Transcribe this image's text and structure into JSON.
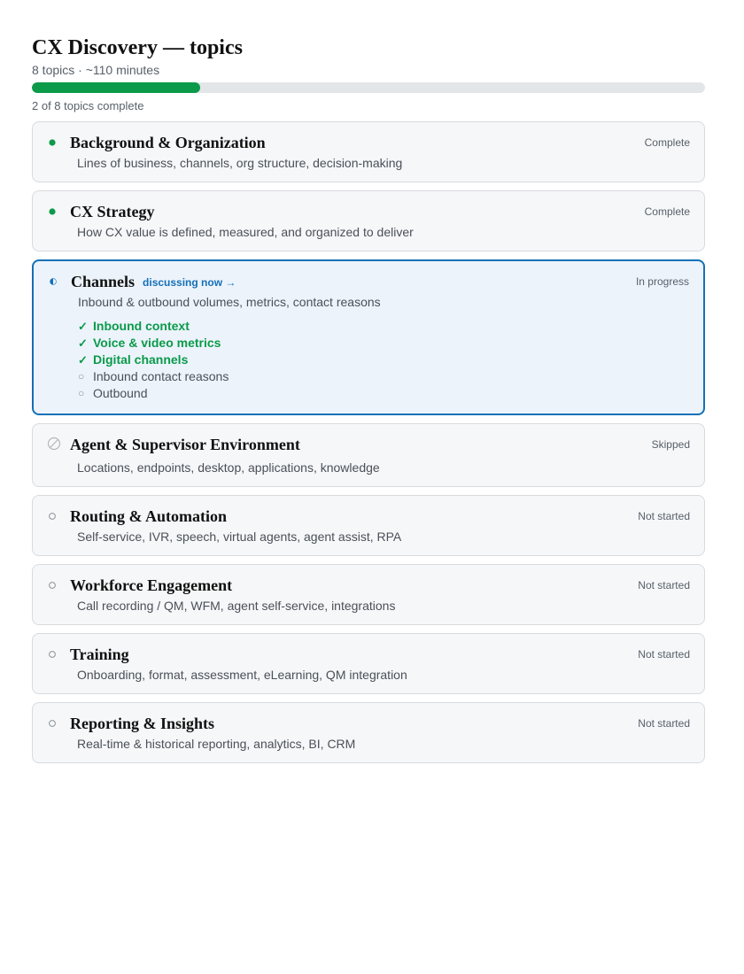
{
  "header": {
    "title": "CX Discovery — topics",
    "subtitle": "8 topics · ~110 minutes"
  },
  "progress": {
    "completed": 2,
    "total": 8,
    "fraction": 0.25,
    "caption": "2 of 8 topics complete"
  },
  "colors": {
    "complete": "#0a9a4a",
    "active": "#1470b8",
    "muted": "#8b939c"
  },
  "topics": [
    {
      "title": "Background & Organization",
      "description": "Lines of business, channels, org structure, decision-making",
      "status": "Complete",
      "icon": "filled-dot-icon"
    },
    {
      "title": "CX Strategy",
      "description": "How CX value is defined, measured, and organized to deliver",
      "status": "Complete",
      "icon": "filled-dot-icon"
    },
    {
      "title": "Channels",
      "description": "Inbound & outbound volumes, metrics, contact reasons",
      "status": "In progress",
      "icon": "half-dot-icon",
      "discussing": "discussing now →",
      "subtopics": [
        {
          "label": "Inbound context",
          "done": true,
          "mark": "✓"
        },
        {
          "label": "Voice & video metrics",
          "done": true,
          "mark": "✓"
        },
        {
          "label": "Digital channels",
          "done": true,
          "mark": "✓"
        },
        {
          "label": "Inbound contact reasons",
          "done": false,
          "mark": "○"
        },
        {
          "label": "Outbound",
          "done": false,
          "mark": "○"
        }
      ]
    },
    {
      "title": "Agent & Supervisor Environment",
      "description": "Locations, endpoints, desktop, applications, knowledge",
      "status": "Skipped",
      "icon": "skipped-circle-icon"
    },
    {
      "title": "Routing & Automation",
      "description": "Self-service, IVR, speech, virtual agents, agent assist, RPA",
      "status": "Not started",
      "icon": "empty-circle-icon"
    },
    {
      "title": "Workforce Engagement",
      "description": "Call recording / QM, WFM, agent self-service, integrations",
      "status": "Not started",
      "icon": "empty-circle-icon"
    },
    {
      "title": "Training",
      "description": "Onboarding, format, assessment, eLearning, QM integration",
      "status": "Not started",
      "icon": "empty-circle-icon"
    },
    {
      "title": "Reporting & Insights",
      "description": "Real-time & historical reporting, analytics, BI, CRM",
      "status": "Not started",
      "icon": "empty-circle-icon"
    }
  ]
}
